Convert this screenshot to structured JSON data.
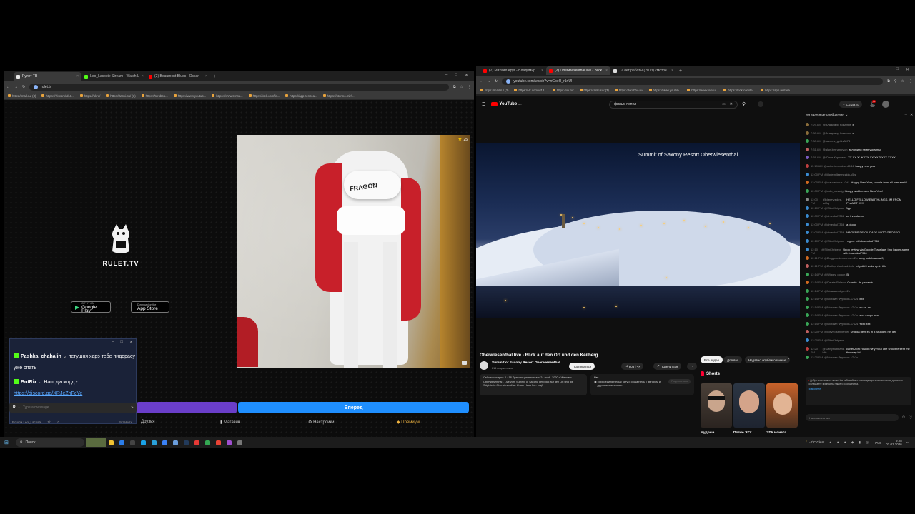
{
  "left_browser": {
    "tabs": [
      {
        "label": "Рулет ТВ",
        "active": true,
        "color": "#e8e8e8"
      },
      {
        "label": "Leo_Lacoste Stream - Watch L",
        "active": false,
        "color": "#53fc18"
      },
      {
        "label": "(2) Beaumont Blues - Oscar",
        "active": false,
        "color": "#ff0000"
      }
    ],
    "url": "rulet.tv",
    "bookmarks": [
      "https://mail.ru/ (3)",
      "https://vk.com/id18...",
      "https://okru/",
      "https://tanki.su/ (3)",
      "https://torobbo...",
      "https://www.youtub...",
      "https://www.tensu...",
      "https://kick.com/le...",
      "https://app.restrea...",
      "https://stormo.mir/..."
    ]
  },
  "rulet": {
    "logo_text": "RULET.TV",
    "google_play": {
      "small": "GET IT ON",
      "big": "Google Play"
    },
    "app_store": {
      "small": "Download on the",
      "big": "App Store"
    },
    "cam_brand": "FRAGON",
    "cam_badge": "25",
    "next_button": "Вперед",
    "message_placeholder": "Type a message...",
    "nav": {
      "friends": "Друзья",
      "shop": "Магазин",
      "settings": "Настройки",
      "premium": "Премиум"
    },
    "status": {
      "user": "Вошли Leo_Lacoste",
      "count_a": "1/1",
      "count_b": "0",
      "right": "Вставить"
    }
  },
  "chat_window": {
    "messages": [
      {
        "user": "Pashka_chahalin",
        "text": "петушня харэ тебе пидорасу уже спать"
      },
      {
        "user": "BotRix",
        "text": "Наш дискорд -"
      }
    ],
    "link": "https://discord.gg/XRJeZhFcYe"
  },
  "right_browser": {
    "tabs": [
      {
        "label": "(2) Михаил Круг - Владимир",
        "active": false,
        "color": "#ff0000"
      },
      {
        "label": "(2) Oberwiesenthal live - Blick",
        "active": true,
        "color": "#ff0000"
      },
      {
        "label": "12 лет работы (2013) смотре",
        "active": false,
        "color": "#dddddd"
      }
    ],
    "url": "youtube.com/watch?v=nGoeU_r1nUI",
    "bookmarks": [
      "https://mail.ru/ (3)",
      "https://vk.com/id18...",
      "https://ok.ru/",
      "https://tanki.su/ (3)",
      "https://torobbo.ru/",
      "https://www.youtub...",
      "https://www.tensu...",
      "https://kick.com/le...",
      "https://app.restrea..."
    ]
  },
  "youtube": {
    "logo": "YouTube",
    "country": "RU",
    "search_value": "фильм пепел",
    "create": "Создать",
    "notif_count": "9+",
    "video_overlay": "Summit of Saxony Resort Oberwiesenthal",
    "title": "Oberwiesenthal live - Blick auf den Ort und den Keilberg",
    "channel": "Summit of Saxony Resort Oberwiesenthal",
    "subs": "214 подписчиков",
    "subscribe": "Подписаться",
    "likes": "808",
    "share": "Поделиться",
    "description": "Сейчас смотрят: 1 418  Трансляция началась 24 нояб. 2020 г. Webcam Oberwiesenthal - Live vom Summit of Saxony der Blick auf den Ort und die Skipiste in Oberwiesenthal. Unser Haus fin... ещё",
    "chat_label": "Чат",
    "chat_join": "Присоединяйтесь к чату и общайтесь с автором и другими зрителями.",
    "chat_join_btn": "Подписаться",
    "filters": [
      "Все видео",
      "Для вас",
      "Недавно опубликованные"
    ],
    "shorts_label": "Shorts",
    "shorts": [
      "Мудрые",
      "Позже ЭТУ",
      "ЭТА монета"
    ],
    "chat_header": "Интересные сообщения",
    "chat_input": "Напишите в чат",
    "chat_notice": "Добро пожаловать в чат! Не забывайте о конфиденциальности своих данных и соблюдайте принципы нашего сообщества.",
    "chat_notice_link": "Подробнее",
    "chat_messages": [
      {
        "time": "7:29 AM",
        "user": "@Владимир Ковалев",
        "text": "х",
        "color": "#8a6d3b"
      },
      {
        "time": "7:30 AM",
        "user": "@Владимир Ковалев",
        "text": "х",
        "color": "#8a6d3b"
      },
      {
        "time": "7:30 AM",
        "user": "@lawrenz_gettis3074",
        "text": "",
        "color": "#3aa657"
      },
      {
        "time": "7:31 AM",
        "user": "@alan-bernanovich",
        "text": "включили гимн украины",
        "color": "#c06060"
      },
      {
        "time": "7:38 AM",
        "user": "@Юлия Корнеева",
        "text": "ХХ ХХ Ж ЖХХХ ХХ ХХ 3 ХХХ ХХХХ",
        "color": "#7a5bc0"
      },
      {
        "time": "11:18 AM",
        "user": "@antonio-ventrum6144",
        "text": "happy new year!",
        "color": "#c04040"
      },
      {
        "time": "12:00 PM",
        "user": "@iloriemilleemezkin-y5ts",
        "text": "",
        "color": "#3a8bd0"
      },
      {
        "time": "12:00 PM",
        "user": "@claudefocus-s2d1",
        "text": "Happy New Year, people from all over earth!",
        "color": "#d06a20"
      },
      {
        "time": "12:00 PM",
        "user": "@colo_nostalg",
        "text": "Happy and blessed New Year!",
        "color": "#3aa657"
      },
      {
        "time": "12:00 PM",
        "user": "@denevredes-s4fq",
        "text": "HELLO FELLOW EARTHLINGS, IM FROM PLANET X!!!!!",
        "color": "#888888"
      },
      {
        "time": "12:10 PM",
        "user": "@SlimChripeon",
        "text": "Бур",
        "color": "#3a8bd0"
      },
      {
        "time": "12:00 PM",
        "user": "@dmeckul7366",
        "text": "ooi ihrowlerrm",
        "color": "#3a8bd0"
      },
      {
        "time": "12:00 PM",
        "user": "@dmeckul7366",
        "text": "ta okolo",
        "color": "#3a8bd0"
      },
      {
        "time": "12:00 PM",
        "user": "@dmeckul7366",
        "text": "IMAGENS DE CIUDADE MATO GROSSO!",
        "color": "#3a8bd0"
      },
      {
        "time": "12:10 PM",
        "user": "@SlimChripeon",
        "text": "I agree with bnanokal7966",
        "color": "#3a8bd0"
      },
      {
        "time": "12:10 PM",
        "user": "@SlimChripeon",
        "text": "Upon review via Google Translate, I no longer agree with bnanokal7966",
        "color": "#3a8bd0"
      },
      {
        "time": "12:11 PM",
        "user": "@Bulgpekulamoonba-o2w",
        "text": "omg look Iosanta fly",
        "color": "#d06a20"
      },
      {
        "time": "12:11 PM",
        "user": "@Balthyrnhubbard-bblc",
        "text": "why did i wake up in this",
        "color": "#c06060"
      },
      {
        "time": "12:14 PM",
        "user": "@Wiggly_oooch",
        "text": "В",
        "color": "#3aa657"
      },
      {
        "time": "12:14 PM",
        "user": "@DelaferPalacio",
        "text": "Grande. de panamá",
        "color": "#d06a20"
      },
      {
        "time": "12:14 PM",
        "user": "@Мишакем8yc-z2n",
        "text": "",
        "color": "#3aa657"
      },
      {
        "time": "12:14 PM",
        "user": "@Михаил Фуросов-s7s2s",
        "text": "ххх",
        "color": "#3aa657"
      },
      {
        "time": "12:14 PM",
        "user": "@Михаил Фуросов-s7s2s",
        "text": "хо хх. хх",
        "color": "#3aa657"
      },
      {
        "time": "12:14 PM",
        "user": "@Михаил Фуросов-s7s2s",
        "text": "т от хлорс.хнл",
        "color": "#3aa657"
      },
      {
        "time": "12:14 PM",
        "user": "@Михаил Фуросов-s7s2s",
        "text": "тохо ххх",
        "color": "#3aa657"
      },
      {
        "time": "12:20 PM",
        "user": "@IceyRosenberger",
        "text": "Und da geht es in 3 Stunden hin geil",
        "color": "#c06060"
      },
      {
        "time": "12:20 PM",
        "user": "@SlimChripeon",
        "text": "",
        "color": "#3a8bd0"
      },
      {
        "time": "12:20 PM",
        "user": "@KathyHubbard-blic",
        "text": "carrel Zoro roscon why YouTube showthe sent me this way lol",
        "color": "#c04040"
      },
      {
        "time": "12:20 PM",
        "user": "@Михаил Фуросов-s7s2s",
        "text": "",
        "color": "#3aa657"
      }
    ]
  },
  "taskbar": {
    "search": "Поиск",
    "weather": "-2°C  Clear",
    "lang": "РУС",
    "time": "9:28",
    "date": "02.01.2026"
  }
}
